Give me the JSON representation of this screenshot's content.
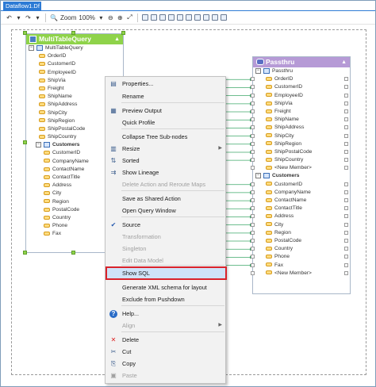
{
  "window": {
    "tab_title": "Dataflow1.Df"
  },
  "toolbar": {
    "zoom_label": "Zoom",
    "zoom_value": "100%"
  },
  "left_node": {
    "title": "MultiTableQuery",
    "subheader": "MultiTableQuery",
    "fields": [
      "OrderID",
      "CustomerID",
      "EmployeeID",
      "ShipVia",
      "Freight",
      "ShipName",
      "ShipAddress",
      "ShipCity",
      "ShipRegion",
      "ShipPostalCode",
      "ShipCountry"
    ],
    "group_label": "Customers",
    "group_fields": [
      "CustomerID",
      "CompanyName",
      "ContactName",
      "ContactTitle",
      "Address",
      "City",
      "Region",
      "PostalCode",
      "Country",
      "Phone",
      "Fax"
    ]
  },
  "right_node": {
    "title": "Passthru",
    "subheader": "Passthru",
    "fields": [
      "OrderID",
      "CustomerID",
      "EmployeeID",
      "ShipVia",
      "Freight",
      "ShipName",
      "ShipAddress",
      "ShipCity",
      "ShipRegion",
      "ShipPostalCode",
      "ShipCountry",
      "<New Member>"
    ],
    "group_label": "Customers",
    "group_fields": [
      "CustomerID",
      "CompanyName",
      "ContactName",
      "ContactTitle",
      "Address",
      "City",
      "Region",
      "PostalCode",
      "Country",
      "Phone",
      "Fax",
      "<New Member>"
    ]
  },
  "context_menu": {
    "items": [
      {
        "label": "Properties...",
        "icon": "properties-icon"
      },
      {
        "label": "Rename",
        "icon": ""
      },
      {
        "label": "Preview Output",
        "icon": "preview-icon"
      },
      {
        "label": "Quick Profile",
        "icon": ""
      },
      {
        "label": "Collapse Tree Sub-nodes",
        "icon": ""
      },
      {
        "label": "Resize",
        "icon": "resize-icon",
        "submenu": true
      },
      {
        "label": "Sorted",
        "icon": "sort-icon"
      },
      {
        "label": "Show Lineage",
        "icon": "lineage-icon"
      },
      {
        "label": "Delete Action and Reroute Maps",
        "icon": "",
        "disabled": true
      },
      {
        "label": "Save as Shared Action",
        "icon": ""
      },
      {
        "label": "Open Query Window",
        "icon": ""
      },
      {
        "label": "Source",
        "icon": "check-icon"
      },
      {
        "label": "Transformation",
        "icon": "",
        "disabled": true
      },
      {
        "label": "Singleton",
        "icon": "",
        "disabled": true
      },
      {
        "label": "Edit Data Model",
        "icon": "",
        "disabled": true
      },
      {
        "label": "Show SQL",
        "icon": ""
      },
      {
        "label": "Generate XML schema for layout",
        "icon": ""
      },
      {
        "label": "Exclude from Pushdown",
        "icon": ""
      },
      {
        "label": "Help...",
        "icon": "help-icon"
      },
      {
        "label": "Align",
        "icon": "",
        "disabled": true,
        "submenu": true
      },
      {
        "label": "Delete",
        "icon": "delete-icon"
      },
      {
        "label": "Cut",
        "icon": "cut-icon"
      },
      {
        "label": "Copy",
        "icon": "copy-icon"
      },
      {
        "label": "Paste",
        "icon": "paste-icon",
        "disabled": true
      }
    ],
    "highlighted": "Show SQL"
  },
  "colors": {
    "left_header": "#8fd34a",
    "right_header": "#b69ad6",
    "highlight_border": "#d9232b",
    "highlight_fill": "#cfe3f8",
    "link_color": "#3fa96a"
  }
}
